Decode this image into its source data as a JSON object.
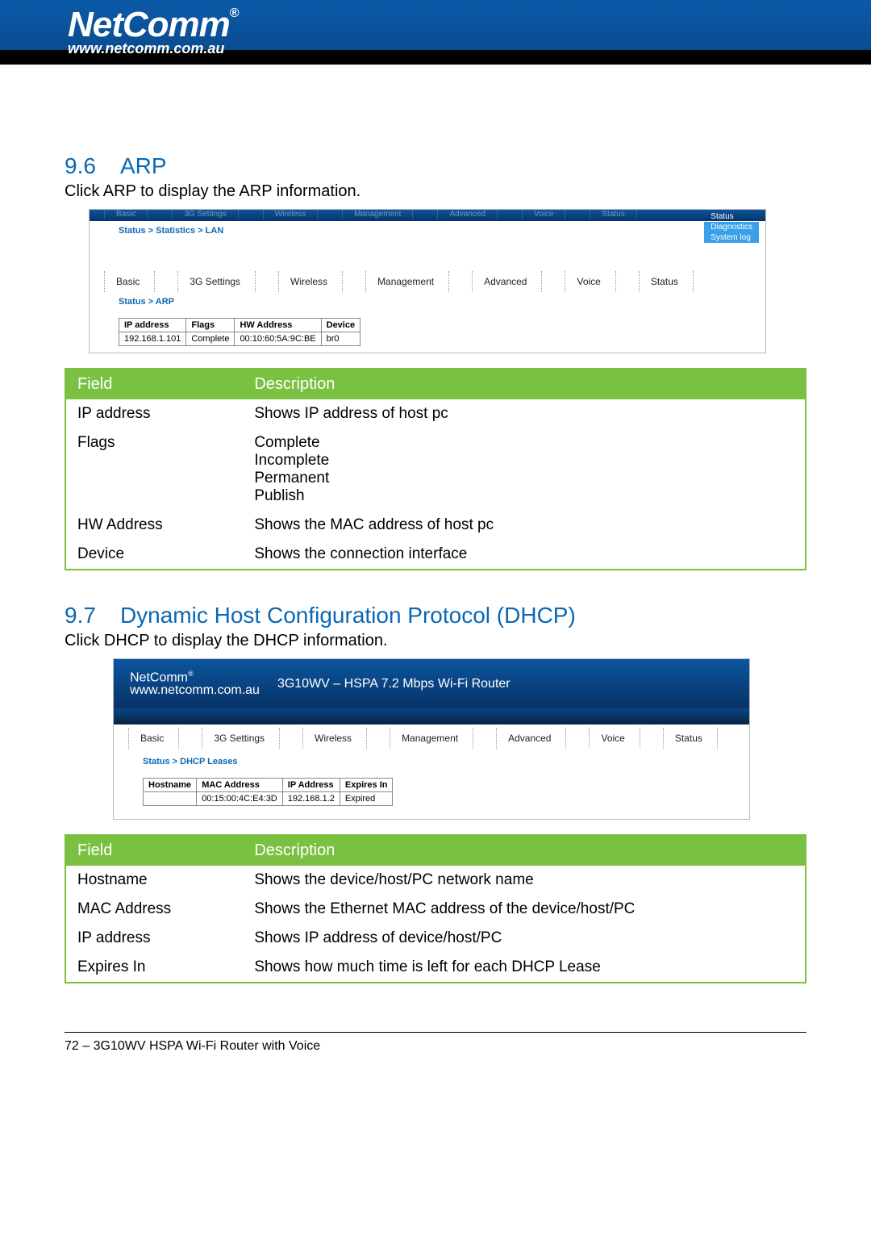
{
  "brand": {
    "name": "NetComm",
    "reg": "®",
    "url": "www.netcomm.com.au"
  },
  "section_arp": {
    "num": "9.6",
    "title": "ARP",
    "intro": "Click ARP to display the ARP information."
  },
  "embed1": {
    "fade_menu": [
      "Basic",
      "3G Settings",
      "Wireless",
      "Management",
      "Advanced",
      "Voice",
      "Status"
    ],
    "side": [
      "Status",
      "Diagnostics",
      "System log"
    ],
    "crumb1": "Status > Statistics > LAN",
    "menu": [
      "Basic",
      "3G Settings",
      "Wireless",
      "Management",
      "Advanced",
      "Voice",
      "Status"
    ],
    "crumb2": "Status > ARP",
    "arp_headers": [
      "IP address",
      "Flags",
      "HW Address",
      "Device"
    ],
    "arp_row": [
      "192.168.1.101",
      "Complete",
      "00:10:60:5A:9C:BE",
      "br0"
    ]
  },
  "arp_desc": {
    "head": [
      "Field",
      "Description"
    ],
    "rows": [
      {
        "f": "IP address",
        "d": "Shows IP address of host pc"
      },
      {
        "f": "Flags",
        "d": "Complete\nIncomplete\nPermanent\nPublish"
      },
      {
        "f": "HW Address",
        "d": "Shows the MAC address of host pc"
      },
      {
        "f": "Device",
        "d": "Shows the connection interface"
      }
    ]
  },
  "section_dhcp": {
    "num": "9.7",
    "title": "Dynamic Host Configuration Protocol (DHCP)",
    "intro": "Click DHCP to display the DHCP information."
  },
  "embed2": {
    "product": "3G10WV – HSPA 7.2 Mbps Wi-Fi Router",
    "menu": [
      "Basic",
      "3G Settings",
      "Wireless",
      "Management",
      "Advanced",
      "Voice",
      "Status"
    ],
    "crumb": "Status > DHCP Leases",
    "dhcp_headers": [
      "Hostname",
      "MAC Address",
      "IP Address",
      "Expires In"
    ],
    "dhcp_row": [
      "",
      "00:15:00:4C:E4:3D",
      "192.168.1.2",
      "Expired"
    ]
  },
  "dhcp_desc": {
    "head": [
      "Field",
      "Description"
    ],
    "rows": [
      {
        "f": "Hostname",
        "d": "Shows the device/host/PC network name"
      },
      {
        "f": "MAC Address",
        "d": "Shows the Ethernet MAC address of the device/host/PC"
      },
      {
        "f": "IP address",
        "d": "Shows IP address of device/host/PC"
      },
      {
        "f": "Expires In",
        "d": "Shows how much time is left for each DHCP Lease"
      }
    ]
  },
  "footer": "72 – 3G10WV HSPA Wi-Fi Router with Voice"
}
